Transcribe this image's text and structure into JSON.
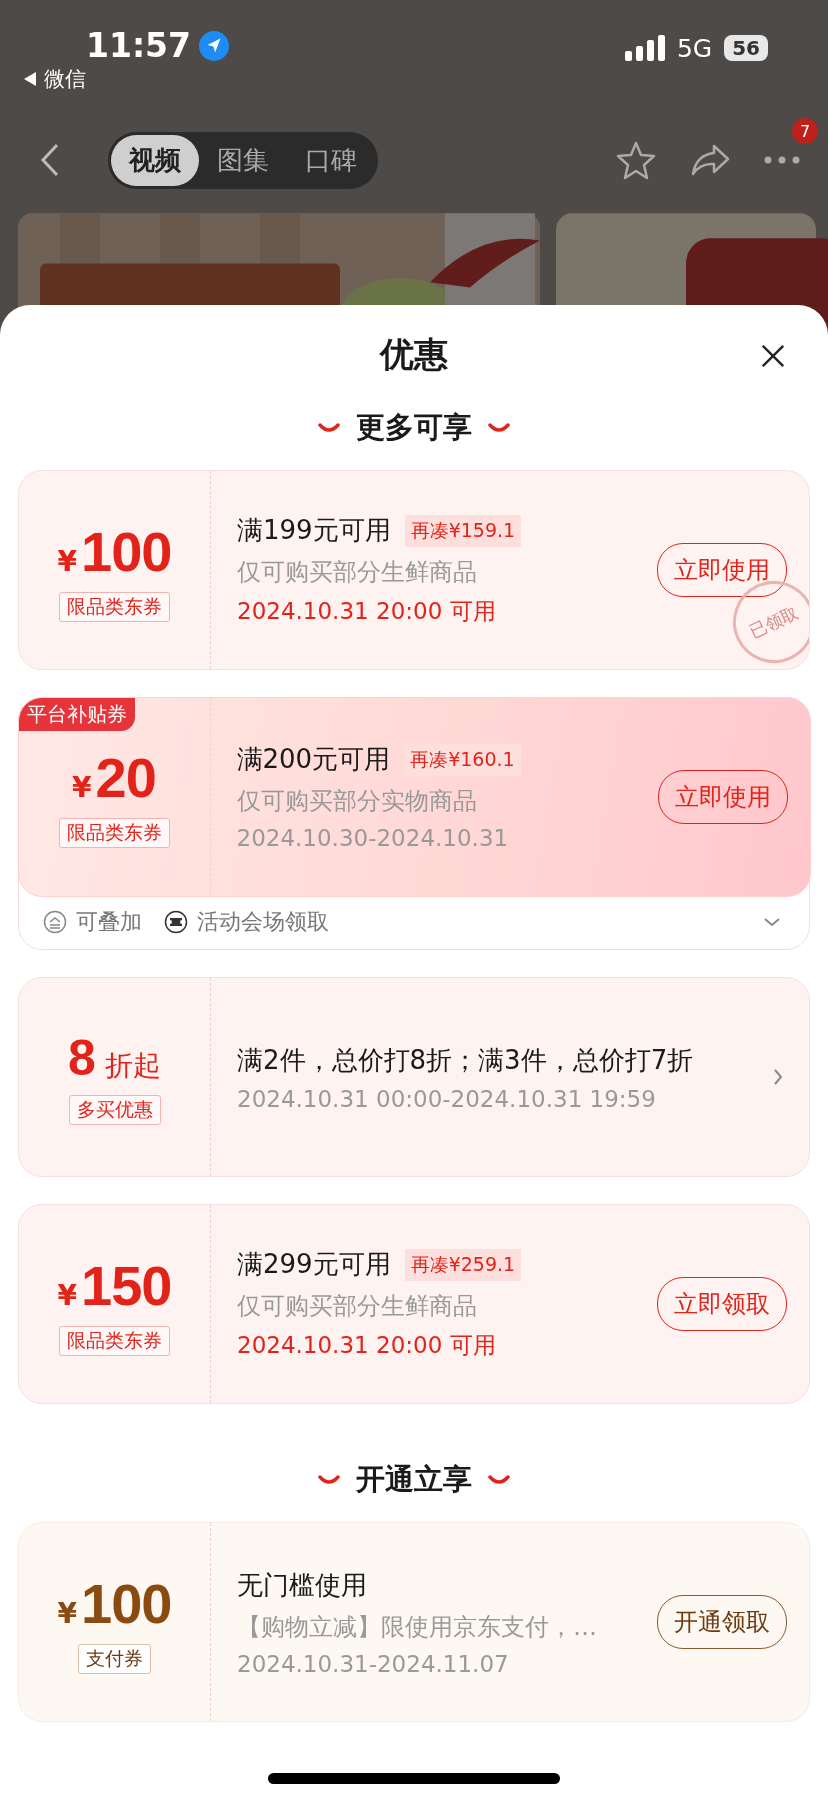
{
  "status_bar": {
    "time": "11:57",
    "back_app": "微信",
    "network": "5G",
    "battery": "56"
  },
  "nav": {
    "tabs": [
      {
        "label": "视频",
        "selected": true
      },
      {
        "label": "图集",
        "selected": false
      },
      {
        "label": "口碑",
        "selected": false
      }
    ],
    "more_badge": "7"
  },
  "sheet": {
    "title": "优惠",
    "sections": [
      {
        "heading": "更多可享",
        "cards": [
          {
            "kind": "coupon",
            "color": "#e2231a",
            "featured": false,
            "currency": "¥",
            "amount": "100",
            "tag": "限品类东券",
            "title": "满199元可用",
            "gap": "再凑¥159.1",
            "desc": "仅可购买部分生鲜商品",
            "date": "2024.10.31 20:00 可用",
            "date_highlight": true,
            "action": "立即使用",
            "stamp": "已领取"
          },
          {
            "kind": "coupon",
            "color": "#e2231a",
            "featured": true,
            "ribbon": "平台补贴券",
            "currency": "¥",
            "amount": "20",
            "tag": "限品类东券",
            "title": "满200元可用",
            "gap": "再凑¥160.1",
            "desc": "仅可购买部分实物商品",
            "date": "2024.10.30-2024.10.31",
            "date_highlight": false,
            "action": "立即使用",
            "footer": [
              {
                "kind": "stack",
                "label": "可叠加"
              },
              {
                "kind": "venue",
                "label": "活动会场领取"
              }
            ]
          },
          {
            "kind": "discount",
            "color": "#e2231a",
            "featured": false,
            "amount": "8",
            "unit": "折起",
            "tag": "多买优惠",
            "title": "满2件，总价打8折；满3件，总价打7折",
            "date": "2024.10.31 00:00-2024.10.31 19:59",
            "date_highlight": false
          },
          {
            "kind": "coupon",
            "color": "#e2231a",
            "featured": false,
            "currency": "¥",
            "amount": "150",
            "tag": "限品类东券",
            "title": "满299元可用",
            "gap": "再凑¥259.1",
            "desc": "仅可购买部分生鲜商品",
            "date": "2024.10.31 20:00 可用",
            "date_highlight": true,
            "action": "立即领取"
          }
        ]
      },
      {
        "heading": "开通立享",
        "cards": [
          {
            "kind": "coupon",
            "color": "#8a4a10",
            "featured": false,
            "currency": "¥",
            "amount": "100",
            "tag": "支付券",
            "title": "无门槛使用",
            "desc": "【购物立减】限使用京东支付，…",
            "date": "2024.10.31-2024.11.07",
            "date_highlight": false,
            "action": "开通领取"
          }
        ]
      }
    ]
  }
}
